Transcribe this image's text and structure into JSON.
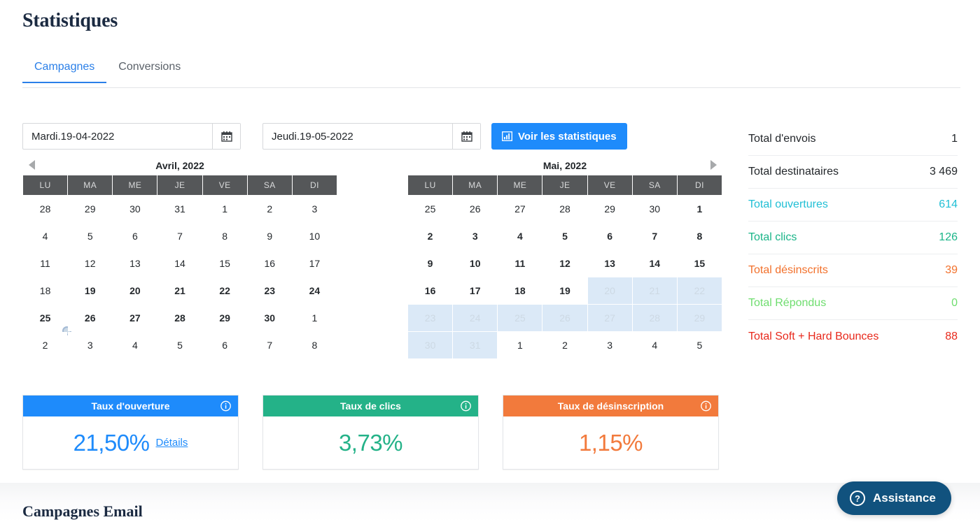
{
  "page_title": "Statistiques",
  "tabs": [
    {
      "label": "Campagnes",
      "active": true
    },
    {
      "label": "Conversions",
      "active": false
    }
  ],
  "filters": {
    "start_date_value": "Mardi.19-04-2022",
    "end_date_value": "Jeudi.19-05-2022",
    "calendar_icon": "calendar-icon",
    "submit_label": "Voir les statistiques",
    "submit_icon": "bar-chart-icon",
    "submit_color": "#1e8bfb"
  },
  "calendars": {
    "weekdays": [
      "LU",
      "MA",
      "ME",
      "JE",
      "VE",
      "SA",
      "DI"
    ],
    "prev_arrow_icon": "triangle-left-icon",
    "next_arrow_icon": "triangle-right-icon",
    "left": {
      "title": "Avril, 2022",
      "weeks": [
        [
          {
            "d": "28",
            "s": "muted"
          },
          {
            "d": "29",
            "s": "muted"
          },
          {
            "d": "30",
            "s": "muted"
          },
          {
            "d": "31",
            "s": "muted"
          },
          {
            "d": "1",
            "s": "inrange"
          },
          {
            "d": "2",
            "s": "inrange"
          },
          {
            "d": "3",
            "s": "inrange"
          }
        ],
        [
          {
            "d": "4",
            "s": "inrange"
          },
          {
            "d": "5",
            "s": "inrange"
          },
          {
            "d": "6",
            "s": "inrange"
          },
          {
            "d": "7",
            "s": "inrange"
          },
          {
            "d": "8",
            "s": "inrange"
          },
          {
            "d": "9",
            "s": "inrange"
          },
          {
            "d": "10",
            "s": "inrange"
          }
        ],
        [
          {
            "d": "11",
            "s": "inrange"
          },
          {
            "d": "12",
            "s": "inrange"
          },
          {
            "d": "13",
            "s": "inrange"
          },
          {
            "d": "14",
            "s": "inrange"
          },
          {
            "d": "15",
            "s": "inrange"
          },
          {
            "d": "16",
            "s": "inrange"
          },
          {
            "d": "17",
            "s": "inrange"
          }
        ],
        [
          {
            "d": "18",
            "s": "inrange"
          },
          {
            "d": "19",
            "s": "selected"
          },
          {
            "d": "20",
            "s": "selected"
          },
          {
            "d": "21",
            "s": "selected"
          },
          {
            "d": "22",
            "s": "selected"
          },
          {
            "d": "23",
            "s": "selected"
          },
          {
            "d": "24",
            "s": "selected"
          }
        ],
        [
          {
            "d": "25",
            "s": "selected",
            "cursor": true
          },
          {
            "d": "26",
            "s": "selected"
          },
          {
            "d": "27",
            "s": "selected"
          },
          {
            "d": "28",
            "s": "selected"
          },
          {
            "d": "29",
            "s": "selected"
          },
          {
            "d": "30",
            "s": "selected"
          },
          {
            "d": "1",
            "s": "muted"
          }
        ],
        [
          {
            "d": "2",
            "s": "muted"
          },
          {
            "d": "3",
            "s": "muted"
          },
          {
            "d": "4",
            "s": "muted"
          },
          {
            "d": "5",
            "s": "muted"
          },
          {
            "d": "6",
            "s": "muted"
          },
          {
            "d": "7",
            "s": "muted"
          },
          {
            "d": "8",
            "s": "muted"
          }
        ]
      ]
    },
    "right": {
      "title": "Mai, 2022",
      "weeks": [
        [
          {
            "d": "25",
            "s": "muted"
          },
          {
            "d": "26",
            "s": "muted"
          },
          {
            "d": "27",
            "s": "muted"
          },
          {
            "d": "28",
            "s": "muted"
          },
          {
            "d": "29",
            "s": "muted"
          },
          {
            "d": "30",
            "s": "muted"
          },
          {
            "d": "1",
            "s": "selected"
          }
        ],
        [
          {
            "d": "2",
            "s": "selected"
          },
          {
            "d": "3",
            "s": "selected"
          },
          {
            "d": "4",
            "s": "selected"
          },
          {
            "d": "5",
            "s": "selected"
          },
          {
            "d": "6",
            "s": "selected"
          },
          {
            "d": "7",
            "s": "selected"
          },
          {
            "d": "8",
            "s": "selected"
          }
        ],
        [
          {
            "d": "9",
            "s": "selected"
          },
          {
            "d": "10",
            "s": "selected"
          },
          {
            "d": "11",
            "s": "selected"
          },
          {
            "d": "12",
            "s": "selected"
          },
          {
            "d": "13",
            "s": "selected"
          },
          {
            "d": "14",
            "s": "selected"
          },
          {
            "d": "15",
            "s": "selected"
          }
        ],
        [
          {
            "d": "16",
            "s": "selected"
          },
          {
            "d": "17",
            "s": "selected"
          },
          {
            "d": "18",
            "s": "selected"
          },
          {
            "d": "19",
            "s": "selected"
          },
          {
            "d": "20",
            "s": "muted inrange"
          },
          {
            "d": "21",
            "s": "muted inrange"
          },
          {
            "d": "22",
            "s": "muted inrange"
          }
        ],
        [
          {
            "d": "23",
            "s": "muted inrange"
          },
          {
            "d": "24",
            "s": "muted inrange"
          },
          {
            "d": "25",
            "s": "muted inrange"
          },
          {
            "d": "26",
            "s": "muted inrange"
          },
          {
            "d": "27",
            "s": "muted inrange"
          },
          {
            "d": "28",
            "s": "muted inrange"
          },
          {
            "d": "29",
            "s": "muted inrange"
          }
        ],
        [
          {
            "d": "30",
            "s": "muted inrange"
          },
          {
            "d": "31",
            "s": "muted inrange"
          },
          {
            "d": "1",
            "s": "muted"
          },
          {
            "d": "2",
            "s": "muted"
          },
          {
            "d": "3",
            "s": "muted"
          },
          {
            "d": "4",
            "s": "muted"
          },
          {
            "d": "5",
            "s": "muted"
          }
        ]
      ]
    }
  },
  "totals": [
    {
      "label": "Total d'envois",
      "value": "1",
      "color": "#23272b"
    },
    {
      "label": "Total destinataires",
      "value": "3 469",
      "color": "#23272b"
    },
    {
      "label": "Total ouvertures",
      "value": "614",
      "color": "#20bfd5"
    },
    {
      "label": "Total clics",
      "value": "126",
      "color": "#1bb589"
    },
    {
      "label": "Total désinscrits",
      "value": "39",
      "color": "#f2712c"
    },
    {
      "label": "Total Répondus",
      "value": "0",
      "color": "#6edd6e"
    },
    {
      "label": "Total Soft + Hard Bounces",
      "value": "88",
      "color": "#e8291c"
    }
  ],
  "cards": [
    {
      "title": "Taux d'ouverture",
      "value": "21,50%",
      "color": "#1e8bfb",
      "link": "Détails",
      "info_icon": "info-icon"
    },
    {
      "title": "Taux de clics",
      "value": "3,73%",
      "color": "#24b288",
      "link": "",
      "info_icon": "info-icon"
    },
    {
      "title": "Taux de désinscription",
      "value": "1,15%",
      "color": "#f27a3c",
      "link": "",
      "info_icon": "info-icon"
    }
  ],
  "bottom": {
    "section_title": "Campagnes Email"
  },
  "assistance": {
    "label": "Assistance",
    "icon": "question-circle-icon",
    "color": "#11527e"
  }
}
